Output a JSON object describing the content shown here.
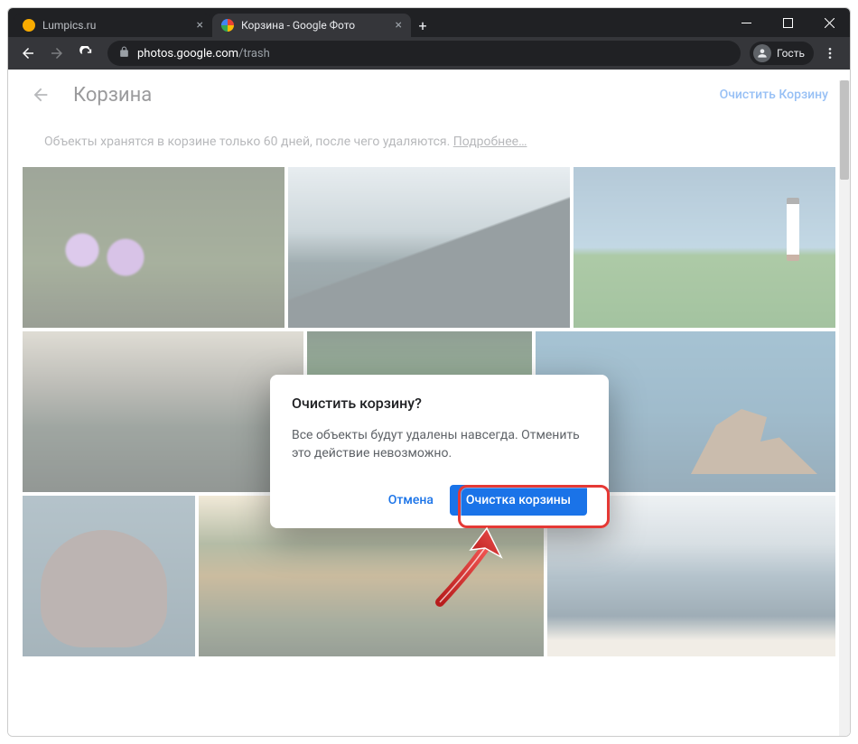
{
  "browser": {
    "tabs": [
      {
        "title": "Lumpics.ru",
        "favicon_color": "#f9ab00",
        "active": false
      },
      {
        "title": "Корзина - Google Фото",
        "favicon_multicolor": true,
        "active": true
      }
    ],
    "new_tab_glyph": "+",
    "window_controls": {
      "minimize": "—",
      "maximize": "▢",
      "close": "✕"
    },
    "url": {
      "host": "photos.google.com",
      "path": "/trash"
    },
    "guest_label": "Гость"
  },
  "page": {
    "title": "Корзина",
    "empty_trash_action": "Очистить Корзину",
    "info_text": "Объекты хранятся в корзине только 60 дней, после чего удаляются. ",
    "info_link": "Подробнее…"
  },
  "dialog": {
    "title": "Очистить корзину?",
    "body": "Все объекты будут удалены навсегда. Отменить это действие невозможно.",
    "cancel": "Отмена",
    "confirm": "Очистка корзины"
  }
}
